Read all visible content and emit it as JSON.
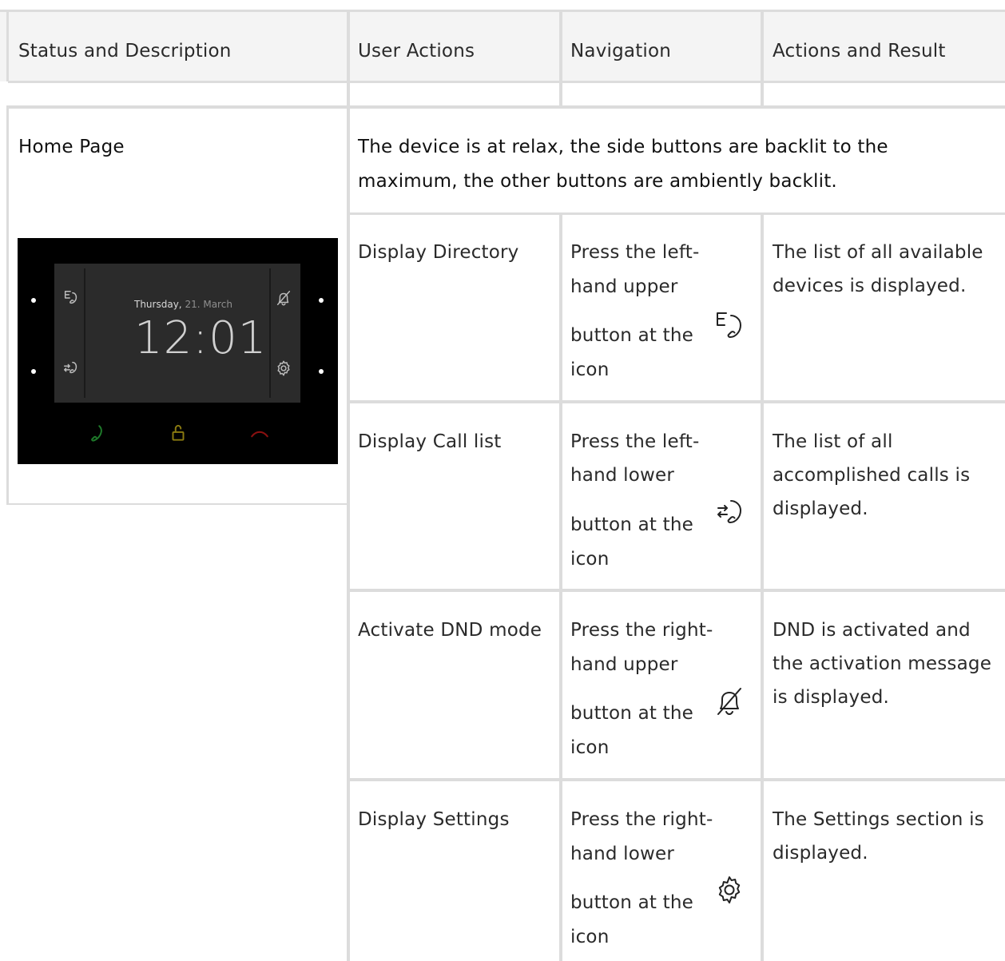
{
  "header": {
    "col1": "Status and Description",
    "col2": "User Actions",
    "col3": "Navigation",
    "col4": "Actions and Result"
  },
  "section": {
    "title": "Home Page",
    "summary": "The device is at relax, the side buttons are backlit to the maximum, the other buttons are ambiently backlit."
  },
  "device_screen": {
    "weekday": "Thursday,",
    "date": "21. March",
    "time": "12:01"
  },
  "rows": [
    {
      "action": "Display Directory",
      "nav_line1": "Press the left-",
      "nav_line2": "hand upper",
      "nav_line3": "button at the",
      "nav_line4": "icon",
      "icon": "directory-icon",
      "result": "The list of all available devices is displayed."
    },
    {
      "action": "Display Call list",
      "nav_line1": "Press the left-",
      "nav_line2": "hand lower",
      "nav_line3": "button at the",
      "nav_line4": "icon",
      "icon": "call-list-icon",
      "result": "The list of all accomplished calls is displayed."
    },
    {
      "action": "Activate DND mode",
      "nav_line1": "Press the right-",
      "nav_line2": "hand upper",
      "nav_line3": "button at the",
      "nav_line4": "icon",
      "icon": "bell-off-icon",
      "result": "DND is activated and the activation message is displayed."
    },
    {
      "action": "Display Settings",
      "nav_line1": "Press the right-",
      "nav_line2": "hand lower",
      "nav_line3": "button at the",
      "nav_line4": "icon",
      "icon": "settings-gear-icon",
      "result": "The Settings section is displayed."
    }
  ],
  "colors": {
    "header_bg": "#f4f4f4",
    "grid": "#dcdcdc",
    "device_bg": "#000000",
    "screen_bg": "#2b2b2b",
    "call_green": "#1e7a2a",
    "unlock_yellow": "#8a7a10",
    "hangup_red": "#8a1010"
  }
}
